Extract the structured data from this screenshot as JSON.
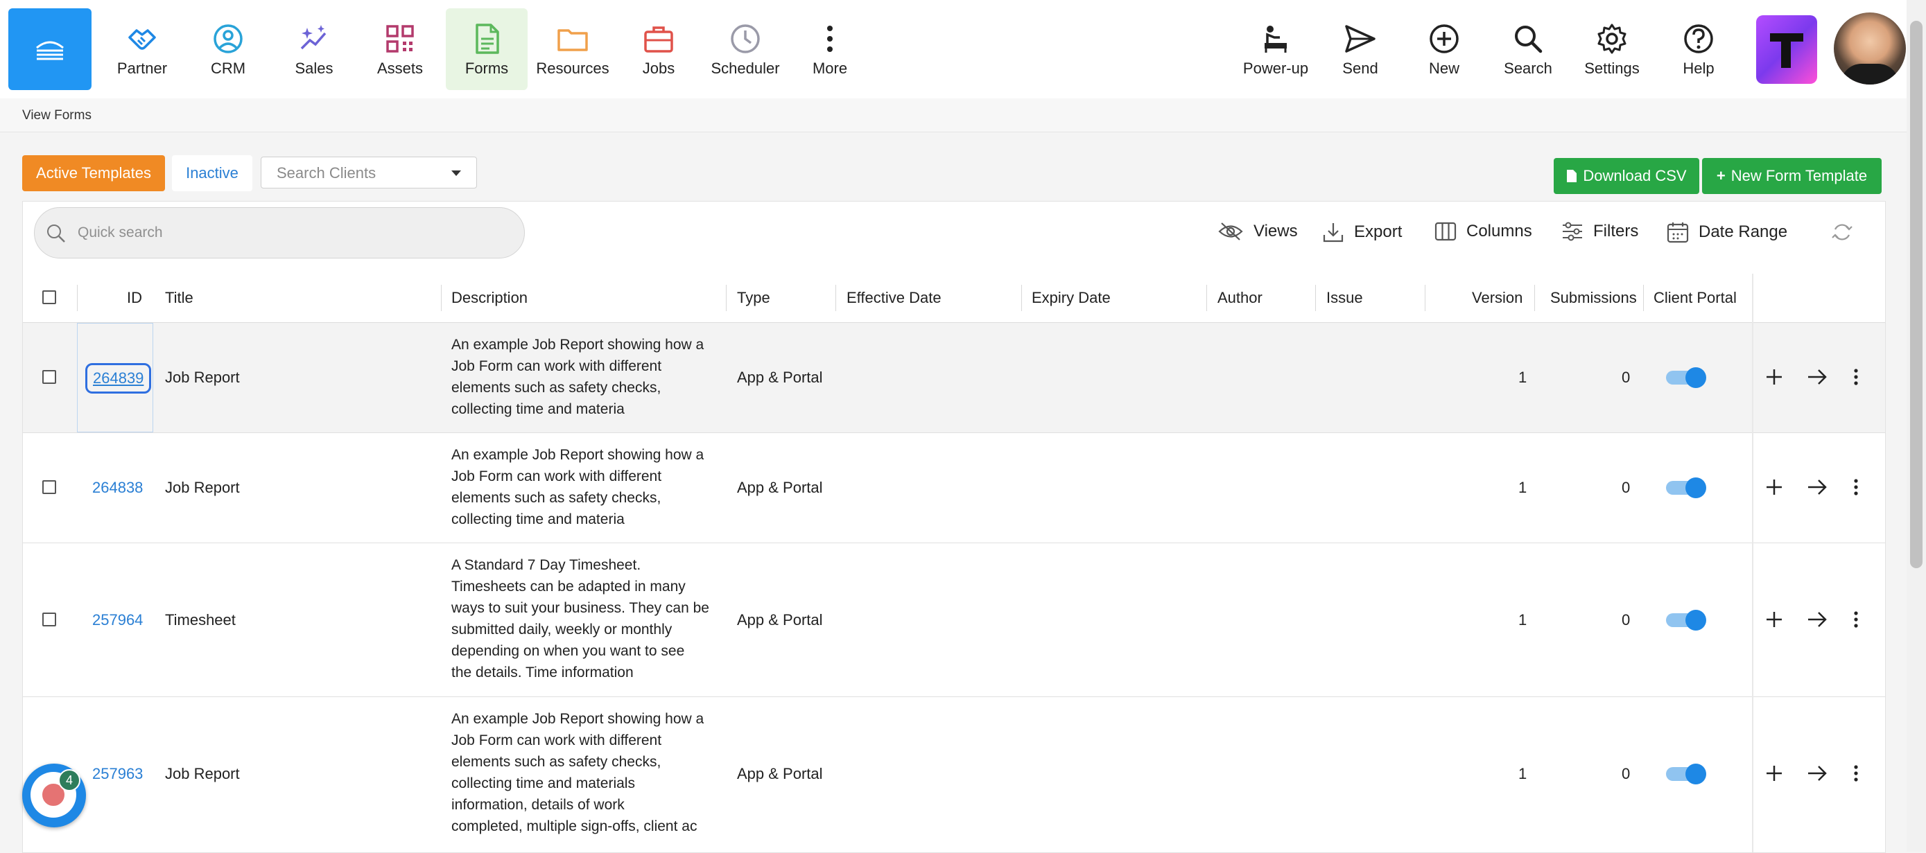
{
  "nav": {
    "items": [
      {
        "label": "Partner",
        "icon": "handshake-icon"
      },
      {
        "label": "CRM",
        "icon": "user-circle-icon"
      },
      {
        "label": "Sales",
        "icon": "sparkle-trend-icon"
      },
      {
        "label": "Assets",
        "icon": "qr-code-icon"
      },
      {
        "label": "Forms",
        "icon": "document-icon"
      },
      {
        "label": "Resources",
        "icon": "folder-icon"
      },
      {
        "label": "Jobs",
        "icon": "briefcase-icon"
      },
      {
        "label": "Scheduler",
        "icon": "clock-icon"
      },
      {
        "label": "More",
        "icon": "vertical-dots-icon"
      }
    ],
    "right": [
      {
        "label": "Power-up",
        "icon": "power-up-icon"
      },
      {
        "label": "Send",
        "icon": "send-icon"
      },
      {
        "label": "New",
        "icon": "plus-circle-icon"
      },
      {
        "label": "Search",
        "icon": "search-icon"
      },
      {
        "label": "Settings",
        "icon": "gear-icon"
      },
      {
        "label": "Help",
        "icon": "help-circle-icon"
      }
    ]
  },
  "breadcrumb": "View Forms",
  "toolbar": {
    "active_templates": "Active Templates",
    "inactive": "Inactive",
    "search_clients_placeholder": "Search Clients",
    "download_csv": "Download CSV",
    "new_form_template": "New Form Template"
  },
  "table_tools": {
    "quick_search_placeholder": "Quick search",
    "views": "Views",
    "export": "Export",
    "columns": "Columns",
    "filters": "Filters",
    "date_range": "Date Range"
  },
  "columns": [
    "ID",
    "Title",
    "Description",
    "Type",
    "Effective Date",
    "Expiry Date",
    "Author",
    "Issue",
    "Version",
    "Submissions",
    "Client Portal"
  ],
  "rows": [
    {
      "id": "264839",
      "title": "Job Report",
      "description": [
        "An example Job Report showing how a",
        "Job Form can work with different",
        "elements such as safety checks,",
        "collecting time and materia"
      ],
      "type": "App & Portal",
      "version": "1",
      "submissions": "0",
      "client_portal": true
    },
    {
      "id": "264838",
      "title": "Job Report",
      "description": [
        "An example Job Report showing how a",
        "Job Form can work with different",
        "elements such as safety checks,",
        "collecting time and materia"
      ],
      "type": "App & Portal",
      "version": "1",
      "submissions": "0",
      "client_portal": true
    },
    {
      "id": "257964",
      "title": "Timesheet",
      "description": [
        "A Standard 7 Day Timesheet.",
        "Timesheets can be adapted in many",
        "ways to suit your business. They can be",
        "submitted daily, weekly or monthly",
        "depending on when you want to see",
        "the details. Time information"
      ],
      "type": "App & Portal",
      "version": "1",
      "submissions": "0",
      "client_portal": true
    },
    {
      "id": "257963",
      "title": "Job Report",
      "description": [
        "An example Job Report showing how a",
        "Job Form can work with different",
        "elements such as safety checks,",
        "collecting time and materials",
        "information, details of work",
        "completed, multiple sign-offs, client ac"
      ],
      "type": "App & Portal",
      "version": "1",
      "submissions": "0",
      "client_portal": true
    }
  ],
  "notification_badge": "4",
  "colors": {
    "primary": "#2196f3",
    "orange": "#f08a24",
    "green": "#28a745",
    "link": "#2a7fd4"
  }
}
